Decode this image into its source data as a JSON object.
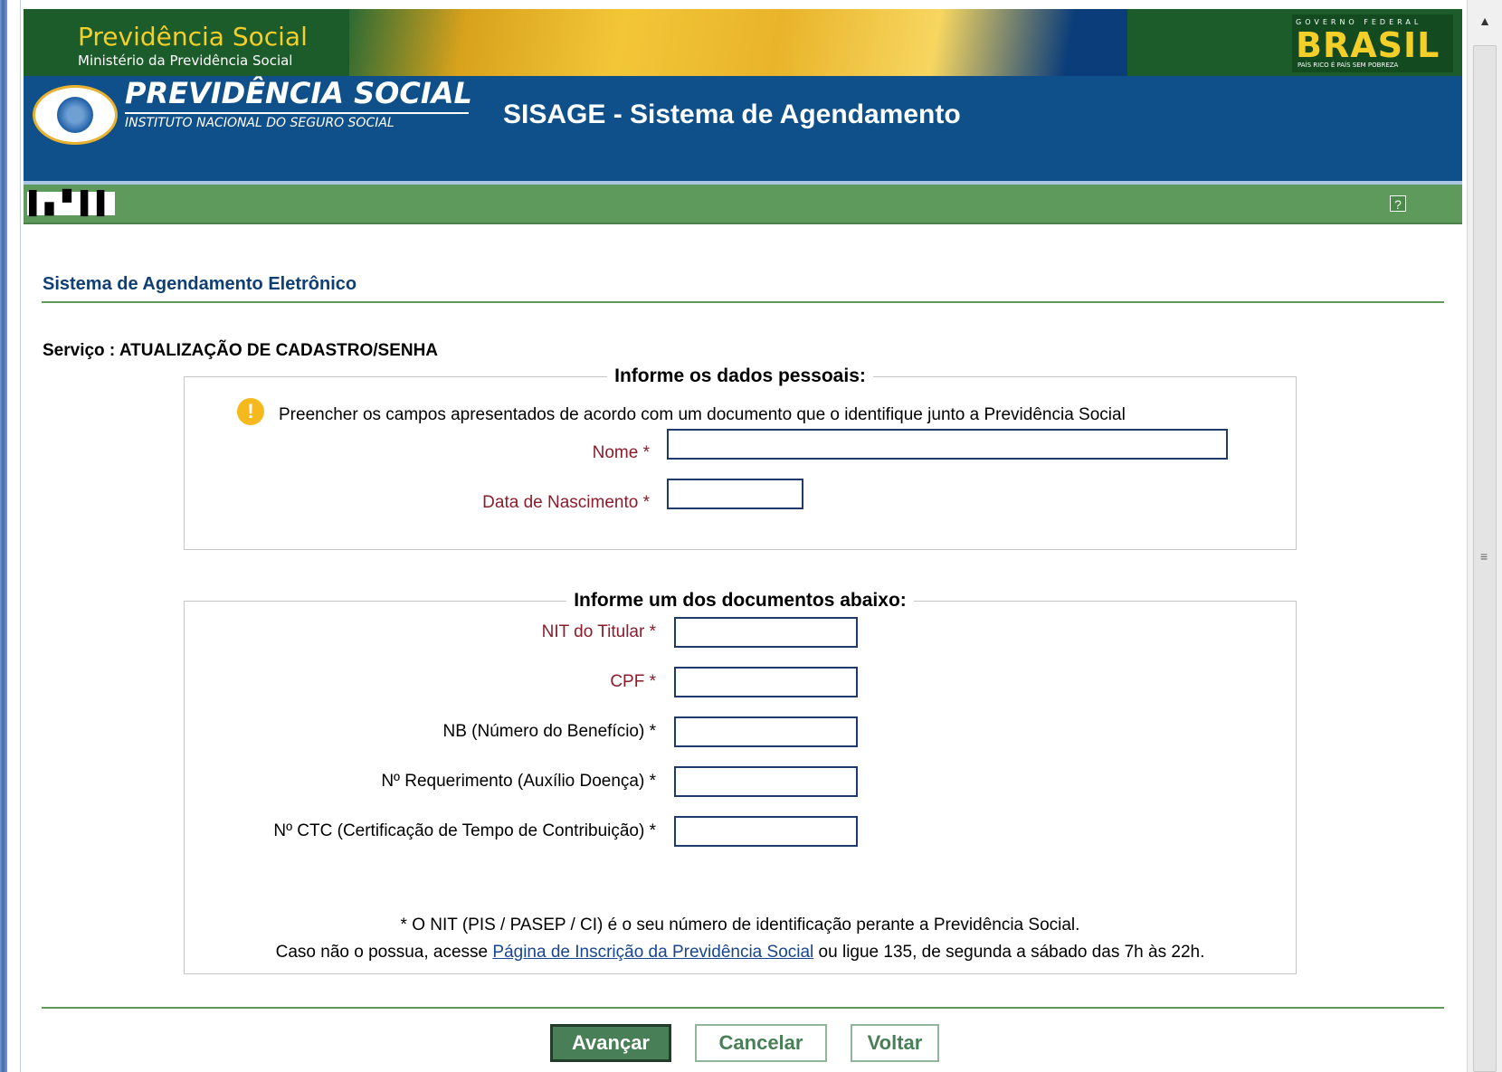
{
  "header": {
    "ps_title": "Previdência Social",
    "ps_subtitle": "Ministério da Previdência Social",
    "brasil_gov": "GOVERNO FEDERAL",
    "brasil_word": "BRASIL",
    "brasil_slogan": "PAÍS RICO É PAÍS SEM POBREZA",
    "inss_title": "PREVIDÊNCIA SOCIAL",
    "inss_subtitle": "INSTITUTO NACIONAL DO SEGURO SOCIAL",
    "system_title": "SISAGE - Sistema de Agendamento",
    "barcode_text": "▌▖▘▌▌",
    "help_label": "?"
  },
  "content": {
    "title": "Sistema de Agendamento Eletrônico",
    "servico": "Serviço : ATUALIZAÇÃO DE CADASTRO/SENHA"
  },
  "personal": {
    "legend": "Informe os dados pessoais:",
    "warning": "Preencher os campos apresentados de acordo com um documento que o identifique junto a Previdência Social",
    "nome_label": "Nome *",
    "nome_value": "",
    "nascimento_label": "Data de Nascimento *",
    "nascimento_value": ""
  },
  "documents": {
    "legend": "Informe um dos documentos abaixo:",
    "nit_label": "NIT do Titular *",
    "cpf_label": "CPF *",
    "nb_label": "NB (Número do Benefício) *",
    "requerimento_label": "Nº Requerimento (Auxílio Doença) *",
    "ctc_label": "Nº CTC (Certificação de Tempo de Contribuição) *",
    "note1": "* O NIT (PIS / PASEP / CI) é o seu número de identificação perante a Previdência Social.",
    "note2_before": "Caso não o possua, acesse ",
    "note2_link": "Página de Inscrição da Previdência Social",
    "note2_after": " ou ligue 135, de segunda a sábado das 7h às 22h."
  },
  "buttons": {
    "avancar": "Avançar",
    "cancelar": "Cancelar",
    "voltar": "Voltar"
  },
  "scrollbar": {
    "up_arrow": "▲",
    "grip": "≡"
  },
  "colors": {
    "header_blue": "#0f4f8a",
    "header_green": "#5d9a5c",
    "title_blue": "#103f74",
    "label_red": "#8a1c2b",
    "button_green": "#497f57"
  }
}
